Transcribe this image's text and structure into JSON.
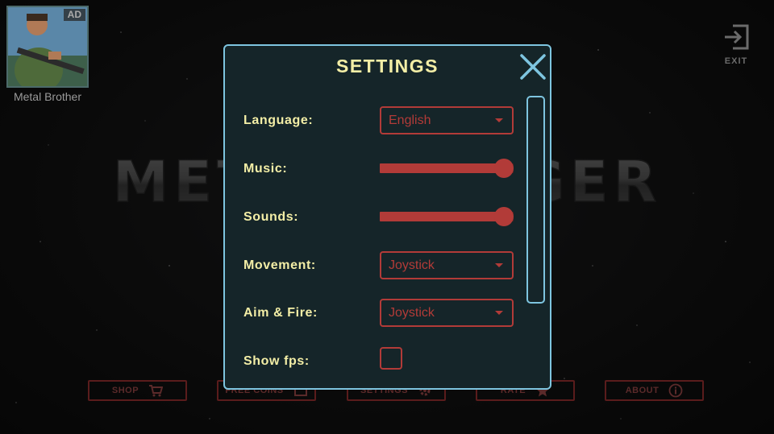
{
  "ad": {
    "badge": "AD",
    "name": "Metal Brother"
  },
  "exit": {
    "label": "EXIT",
    "icon": "exit-icon"
  },
  "background_title": "METAL RANGER",
  "bottom_menu": [
    {
      "label": "SHOP",
      "icon": "cart-icon"
    },
    {
      "label": "FREE COINS",
      "icon": "coins-icon"
    },
    {
      "label": "SETTINGS",
      "icon": "gear-icon"
    },
    {
      "label": "RATE",
      "icon": "star-icon"
    },
    {
      "label": "ABOUT",
      "icon": "info-icon"
    }
  ],
  "settings": {
    "title": "SETTINGS",
    "close_icon": "close-icon",
    "language": {
      "label": "Language:",
      "value": "English"
    },
    "music": {
      "label": "Music:",
      "level": 1.0
    },
    "sounds": {
      "label": "Sounds:",
      "level": 1.0
    },
    "movement": {
      "label": "Movement:",
      "value": "Joystick"
    },
    "aim_fire": {
      "label": "Aim & Fire:",
      "value": "Joystick"
    },
    "show_fps": {
      "label": "Show fps:",
      "checked": false
    }
  },
  "colors": {
    "panel_bg": "#152529",
    "panel_border": "#7ec5e0",
    "label_text": "#f3eea6",
    "control_red": "#b23b38"
  }
}
